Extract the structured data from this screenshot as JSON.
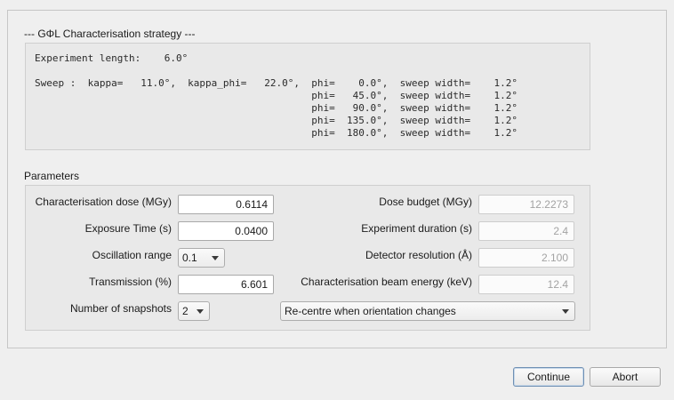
{
  "strategy": {
    "title": "--- GΦL Characterisation strategy ---",
    "experiment_line": "Experiment length:    6.0°",
    "sweep_lines": [
      "Sweep :  kappa=   11.0°,  kappa_phi=   22.0°,  phi=    0.0°,  sweep width=    1.2°",
      "                                               phi=   45.0°,  sweep width=    1.2°",
      "                                               phi=   90.0°,  sweep width=    1.2°",
      "                                               phi=  135.0°,  sweep width=    1.2°",
      "                                               phi=  180.0°,  sweep width=    1.2°"
    ]
  },
  "parameters": {
    "title": "Parameters",
    "characterisation_dose": {
      "label": "Characterisation dose (MGy)",
      "value": "0.6114"
    },
    "exposure_time": {
      "label": "Exposure Time (s)",
      "value": "0.0400"
    },
    "oscillation_range": {
      "label": "Oscillation range",
      "value": "0.1"
    },
    "transmission": {
      "label": "Transmission (%)",
      "value": "6.601"
    },
    "number_of_snapshots": {
      "label": "Number of snapshots",
      "value": "2"
    },
    "dose_budget": {
      "label": "Dose budget (MGy)",
      "value": "12.2273"
    },
    "experiment_duration": {
      "label": "Experiment duration (s)",
      "value": "2.4"
    },
    "detector_resolution": {
      "label": "Detector resolution (Å)",
      "value": "2.100"
    },
    "beam_energy": {
      "label": "Characterisation beam energy (keV)",
      "value": "12.4"
    },
    "recentre_mode": {
      "value": "Re-centre when orientation changes"
    }
  },
  "buttons": {
    "continue": "Continue",
    "abort": "Abort"
  }
}
